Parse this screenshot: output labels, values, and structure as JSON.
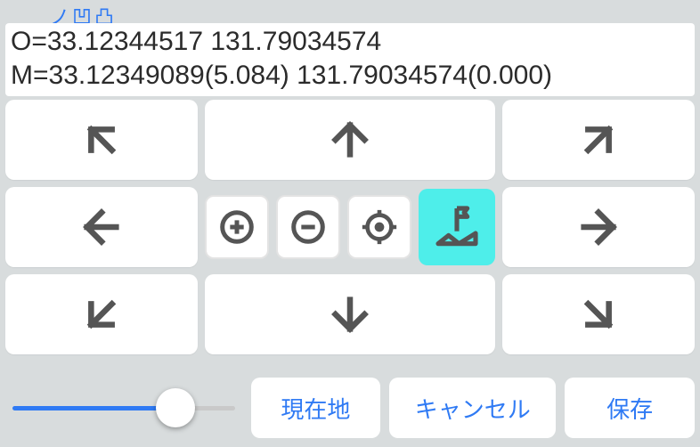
{
  "top_link": "ノ凹凸",
  "coords": {
    "o_line": "O=33.12344517 131.79034574",
    "m_line": "M=33.12349089(5.084) 131.79034574(0.000)"
  },
  "actions": {
    "current": "現在地",
    "cancel": "キャンセル",
    "save": "保存"
  },
  "slider": {
    "value": 0.75
  }
}
